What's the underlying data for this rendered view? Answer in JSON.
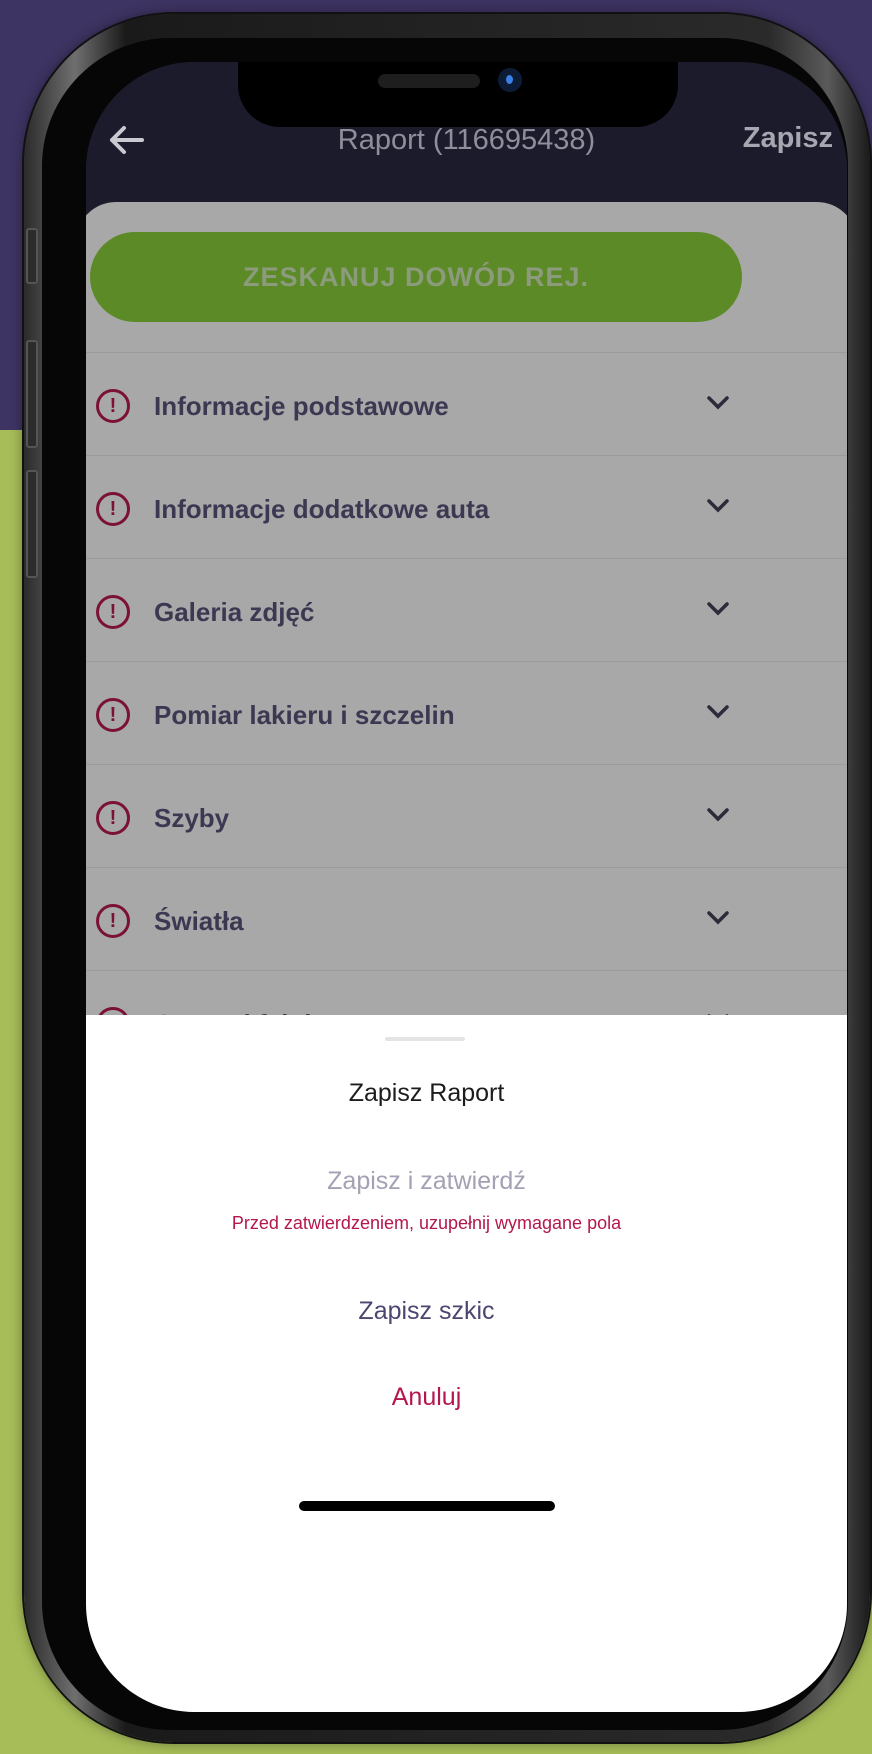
{
  "header": {
    "title": "Raport (116695438)",
    "save_label": "Zapisz",
    "back_icon": "arrow-left-icon"
  },
  "scan_button": {
    "label": "ZESKANUJ DOWÓD REJ."
  },
  "sections": [
    {
      "label": "Informacje podstawowe",
      "status_icon": "alert-circle-icon"
    },
    {
      "label": "Informacje dodatkowe auta",
      "status_icon": "alert-circle-icon"
    },
    {
      "label": "Galeria zdjęć",
      "status_icon": "alert-circle-icon"
    },
    {
      "label": "Pomiar lakieru i szczelin",
      "status_icon": "alert-circle-icon"
    },
    {
      "label": "Szyby",
      "status_icon": "alert-circle-icon"
    },
    {
      "label": "Światła",
      "status_icon": "alert-circle-icon"
    },
    {
      "label": "Opony i felgi",
      "status_icon": "alert-circle-icon"
    }
  ],
  "sheet": {
    "title": "Zapisz Raport",
    "confirm_label": "Zapisz i zatwierdź",
    "warning": "Przed zatwierdzeniem, uzupełnij wymagane pola",
    "draft_label": "Zapisz szkic",
    "cancel_label": "Anuluj"
  },
  "colors": {
    "accent_green": "#5c8a26",
    "alert_red": "#b4164e",
    "text_purple": "#4b4670",
    "background_purple": "#3e3463",
    "background_green": "#a7bd58"
  }
}
